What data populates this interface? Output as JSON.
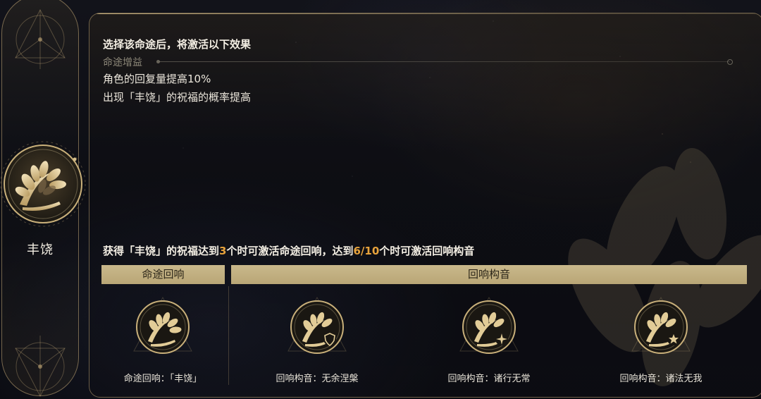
{
  "path": {
    "name": "丰饶",
    "emblem_icon": "wheat-sheaf-icon"
  },
  "panel": {
    "intro": "选择该命途后，将激活以下效果",
    "bonus_label": "命途增益",
    "effects": [
      "角色的回复量提高10%",
      "出现「丰饶」的祝福的概率提高"
    ],
    "requirement": {
      "part1": "获得「丰饶」的祝福达到",
      "num1": "3",
      "part2": "个时可激活命途回响，达到",
      "num2": "6/10",
      "part3": "个时可激活回响构音"
    },
    "accent_color": "#e8a33c"
  },
  "sections": {
    "path_echo_header": "命途回响",
    "echo_timbre_header": "回响构音"
  },
  "echoes": [
    {
      "label": "命途回响：「丰饶」",
      "icon": "wheat-emblem-icon",
      "badge": ""
    },
    {
      "label": "回响构音：无余涅槃",
      "icon": "wheat-emblem-icon",
      "badge": "shield-badge-icon"
    },
    {
      "label": "回响构音：诸行无常",
      "icon": "wheat-emblem-icon",
      "badge": "sparkle-badge-icon"
    },
    {
      "label": "回响构音：诸法无我",
      "icon": "wheat-emblem-icon",
      "badge": "star-badge-icon"
    }
  ]
}
